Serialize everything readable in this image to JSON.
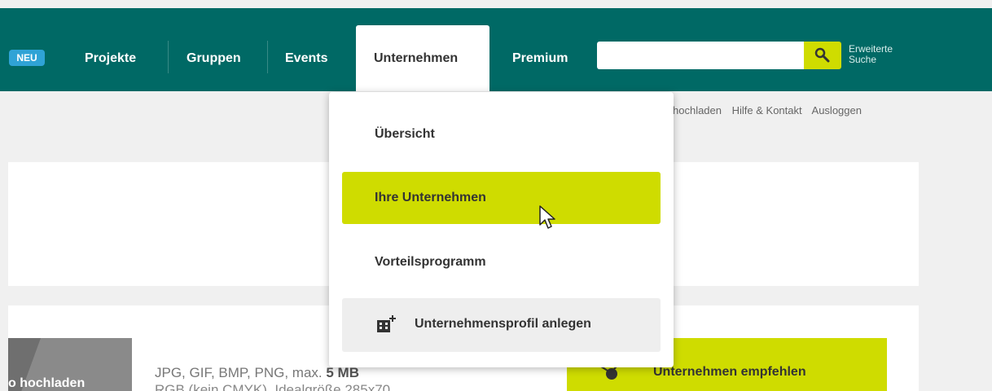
{
  "nav": {
    "badge": "NEU",
    "items": [
      {
        "label": "Projekte"
      },
      {
        "label": "Gruppen"
      },
      {
        "label": "Events"
      },
      {
        "label": "Unternehmen"
      },
      {
        "label": "Premium"
      }
    ],
    "active": "Unternehmen",
    "search": {
      "value": "",
      "placeholder": "",
      "advanced_label": "Erweiterte Suche"
    }
  },
  "subbar": {
    "links": [
      "hochladen",
      "Hilfe & Kontakt",
      "Ausloggen"
    ]
  },
  "dropdown": {
    "items": [
      {
        "label": "Übersicht",
        "state": "normal"
      },
      {
        "label": "Ihre Unternehmen",
        "state": "hover"
      },
      {
        "label": "Vorteilsprogramm",
        "state": "normal"
      },
      {
        "label": "Unternehmensprofil anlegen",
        "state": "action",
        "icon": "building-add-icon"
      }
    ]
  },
  "content": {
    "upload_label": "o hochladen",
    "file_info_line1": "JPG, GIF, BMP, PNG, max.",
    "file_info_size": "5 MB",
    "file_info_line2": "RGB (kein CMYK), Idealgröße 285x70",
    "recommend_button": "Unternehmen empfehlen"
  },
  "colors": {
    "nav_bg": "#006965",
    "accent": "#cfdc00",
    "badge": "#2fa3d6"
  }
}
